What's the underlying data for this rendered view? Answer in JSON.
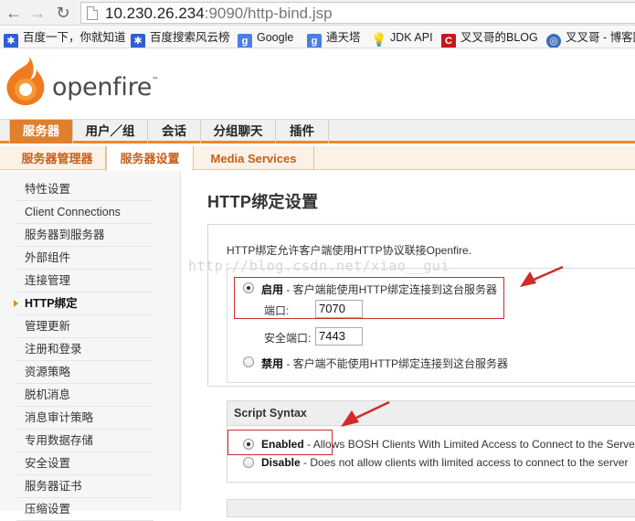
{
  "browser": {
    "url_host": "10.230.26.234",
    "url_rest": ":9090/http-bind.jsp",
    "bookmarks": [
      {
        "label": "百度一下，你就知道",
        "icon": "baidu-paw-icon",
        "color": "#2d5fd6"
      },
      {
        "label": "百度搜索风云榜",
        "icon": "baidu-paw-icon",
        "color": "#2d5fd6"
      },
      {
        "label": "Google",
        "icon": "google-g-icon",
        "color": "#4a7ee8"
      },
      {
        "label": "通天塔",
        "icon": "google-g-icon",
        "color": "#4a7ee8"
      },
      {
        "label": "JDK API",
        "icon": "lightbulb-icon",
        "color": "#d8a417"
      },
      {
        "label": "叉叉哥的BLOG",
        "icon": "csdn-c-icon",
        "color": "#c8161d"
      },
      {
        "label": "叉叉哥 - 博客园",
        "icon": "globe-icon",
        "color": "#3a6cc0"
      }
    ]
  },
  "app": {
    "logo_text": "openfire",
    "logo_tm": "™",
    "main_tabs": [
      "服务器",
      "用户／组",
      "会话",
      "分组聊天",
      "插件"
    ],
    "active_main_tab": "服务器",
    "sub_tabs": [
      "服务器管理器",
      "服务器设置",
      "Media Services"
    ],
    "active_sub_tab": "服务器设置",
    "sidebar": [
      "特性设置",
      "Client Connections",
      "服务器到服务器",
      "外部组件",
      "连接管理",
      "HTTP绑定",
      "管理更新",
      "注册和登录",
      "资源策略",
      "脱机消息",
      "消息审计策略",
      "专用数据存储",
      "安全设置",
      "服务器证书",
      "压缩设置"
    ],
    "active_sidebar": "HTTP绑定"
  },
  "content": {
    "title": "HTTP绑定设置",
    "intro": "HTTP绑定允许客户端使用HTTP协议联接Openfire.",
    "enable_option": {
      "bold": "启用",
      "rest": " - 客户端能使用HTTP绑定连接到这台服务器",
      "selected": true
    },
    "port_label": "端口:",
    "port_value": "7070",
    "secure_port_label": "安全端口:",
    "secure_port_value": "7443",
    "disable_option": {
      "bold": "禁用",
      "rest": " - 客户端不能使用HTTP绑定连接到这台服务器",
      "selected": false
    },
    "script_syntax": {
      "title": "Script Syntax",
      "enabled": {
        "bold": "Enabled",
        "rest": " - Allows BOSH Clients With Limited Access to Connect to the Server",
        "selected": true
      },
      "disabled": {
        "bold": "Disable",
        "rest": " - Does not allow clients with limited access to connect to the server",
        "selected": false
      }
    }
  },
  "watermark": "http://blog.csdn.net/xiao__gui",
  "colors": {
    "accent": "#e0802c",
    "sub_tab_text": "#c0601d",
    "annotation": "#d12b2b"
  }
}
